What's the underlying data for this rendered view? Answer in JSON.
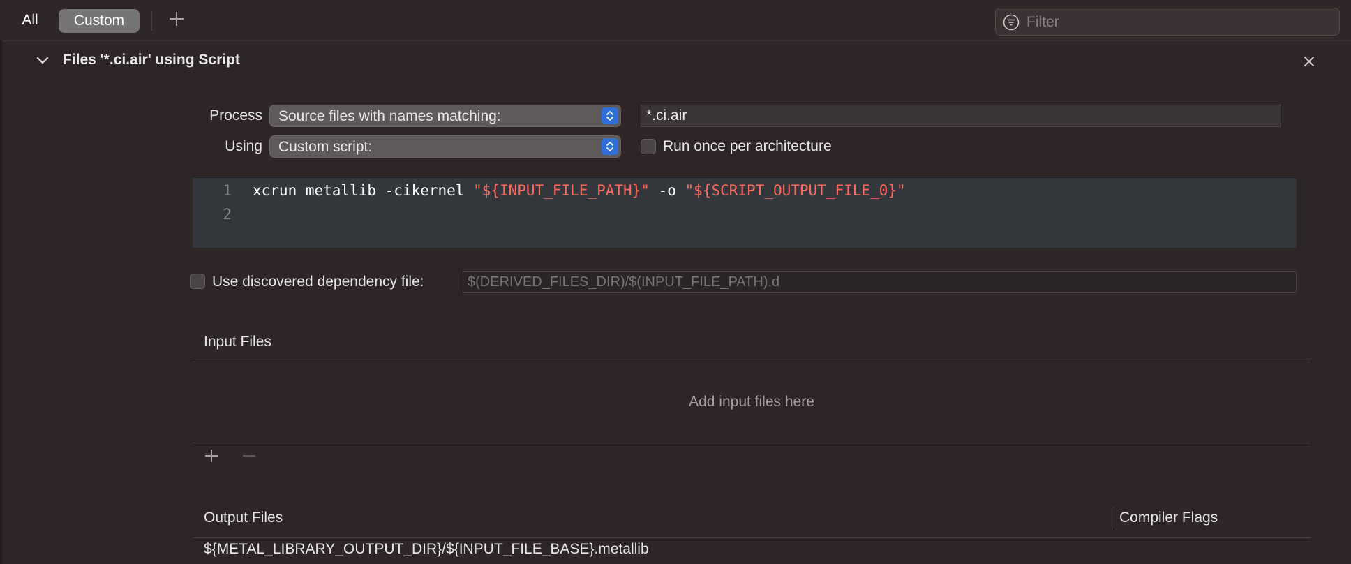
{
  "toolbar": {
    "segments": [
      "All",
      "Custom"
    ],
    "selected_segment": "Custom",
    "add_icon": "plus-icon",
    "filter": {
      "placeholder": "Filter",
      "value": "",
      "icon": "filter-circle-icon"
    }
  },
  "rule": {
    "title": "Files '*.ci.air' using Script",
    "expanded": true,
    "process": {
      "label": "Process",
      "selected": "Source files with names matching:",
      "pattern": "*.ci.air"
    },
    "using": {
      "label": "Using",
      "selected": "Custom script:",
      "run_once_label": "Run once per architecture",
      "run_once_checked": false
    },
    "script": {
      "line_numbers": [
        "1",
        "2"
      ],
      "code": {
        "command": "xcrun metallib -cikernel ",
        "input_arg": "\"${INPUT_FILE_PATH}\"",
        "output_flag": " -o ",
        "output_arg": "\"${SCRIPT_OUTPUT_FILE_0}\""
      }
    },
    "dependency": {
      "label": "Use discovered dependency file:",
      "checked": false,
      "placeholder": "$(DERIVED_FILES_DIR)/$(INPUT_FILE_PATH).d"
    },
    "input_files": {
      "title": "Input Files",
      "empty_message": "Add input files here",
      "add_icon": "plus-icon",
      "remove_icon": "minus-icon"
    },
    "output_files": {
      "title": "Output Files",
      "flags_title": "Compiler Flags",
      "rows": [
        "${METAL_LIBRARY_OUTPUT_DIR}/${INPUT_FILE_BASE}.metallib"
      ]
    }
  },
  "colors": {
    "background": "#2e2626",
    "selected_segment": "#777474",
    "popup_accent": "#2f6fd8",
    "string_literal": "#fc6a5d"
  }
}
